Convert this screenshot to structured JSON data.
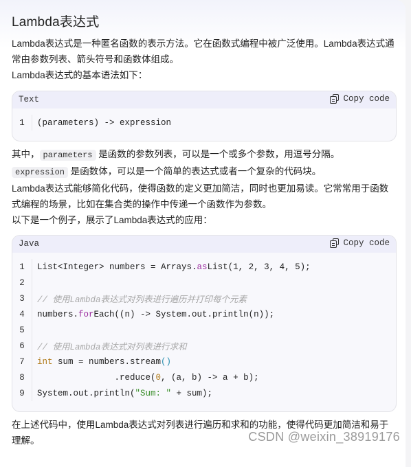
{
  "heading": "Lambda表达式",
  "intro": {
    "line1": "Lambda表达式是一种匿名函数的表示方法。它在函数式编程中被广泛使用。Lambda表达式通常由参数列表、箭头符号和函数体组成。",
    "line2": "Lambda表达式的基本语法如下："
  },
  "syntax_block": {
    "language": "Text",
    "copy_label": "Copy code",
    "lines": [
      {
        "num": "1",
        "text": "(parameters) -> expression"
      }
    ]
  },
  "explanation": {
    "pre1": "其中，",
    "code1": "parameters",
    "mid1": " 是函数的参数列表，可以是一个或多个参数，用逗号分隔。 ",
    "code2": "expression",
    "post1": " 是函数体，可以是一个简单的表达式或者一个复杂的代码块。",
    "line2": "Lambda表达式能够简化代码，使得函数的定义更加简洁，同时也更加易读。它常常用于函数式编程的场景，比如在集合类的操作中传递一个函数作为参数。",
    "line3": "以下是一个例子，展示了Lambda表达式的应用："
  },
  "example_block": {
    "language": "Java",
    "copy_label": "Copy code",
    "line_numbers": [
      "1",
      "2",
      "3",
      "4",
      "5",
      "6",
      "7",
      "8",
      "9"
    ],
    "lines": {
      "l1_a": "List<Integer> numbers = Arrays.",
      "l1_fn": "as",
      "l1_b": "List(1, 2, 3, 4, 5);",
      "l3_comment": "// 使用Lambda表达式对列表进行遍历并打印每个元素",
      "l4_a": "numbers.",
      "l4_fn": "for",
      "l4_b": "Each((n) -> System.out.println(n));",
      "l6_comment": "// 使用Lambda表达式对列表进行求和",
      "l7_kw": "int",
      "l7_a": " sum = numbers.stream",
      "l7_par": "()",
      "l8_a": "               .reduce(",
      "l8_num": "0",
      "l8_b": ", (a, b) -> a + b);",
      "l9_a": "System.out.println(",
      "l9_str": "\"Sum: \"",
      "l9_b": " + sum);"
    }
  },
  "conclusion": "在上述代码中，使用Lambda表达式对列表进行遍历和求和的功能，使得代码更加简洁和易于理解。",
  "watermark": "CSDN @weixin_38919176"
}
